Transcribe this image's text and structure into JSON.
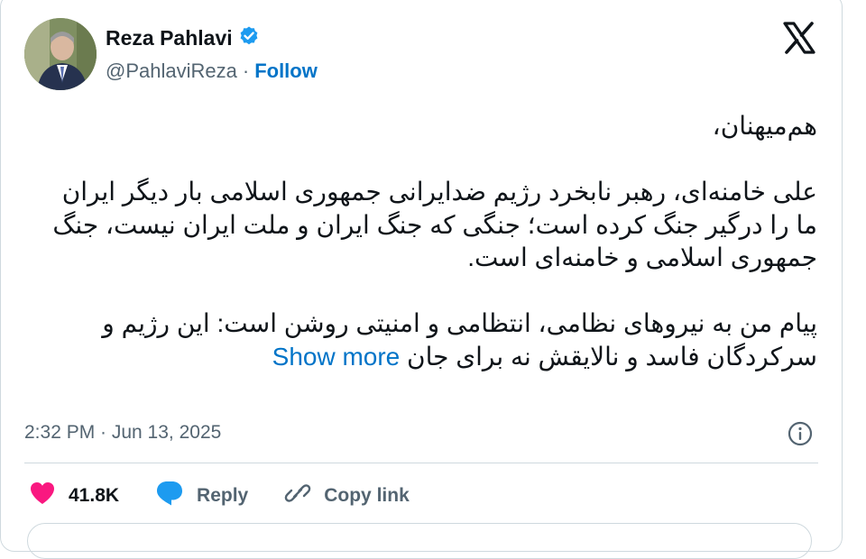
{
  "author": {
    "name": "Reza Pahlavi",
    "handle": "@PahlaviReza",
    "separator": "·",
    "follow_label": "Follow"
  },
  "tweet": {
    "greeting": "هم‌میهنان،",
    "paragraph1": "علی خامنه‌ای، رهبر نابخرد رژیم ضدایرانی جمهوری اسلامی بار دیگر ایران ما را درگیر جنگ کرده است؛ جنگی که جنگ ایران و ملت ایران نیست، جنگ جمهوری اسلامی و خامنه‌ای است.",
    "paragraph2": "پیام من به نیروهای نظامی، انتظامی و امنیتی روشن است: این رژیم و سرکردگان فاسد و نالایقش نه برای جان",
    "show_more": "Show more"
  },
  "timestamp": "2:32 PM · Jun 13, 2025",
  "actions": {
    "likes": "41.8K",
    "reply_label": "Reply",
    "copy_link_label": "Copy link"
  },
  "colors": {
    "link_blue": "#0074c8",
    "verified_blue": "#1d9bf0",
    "heart_red": "#f91880",
    "muted": "#536471"
  },
  "icons": [
    "verified-badge-icon",
    "x-logo-icon",
    "info-icon",
    "heart-icon",
    "reply-bubble-icon",
    "link-icon"
  ]
}
